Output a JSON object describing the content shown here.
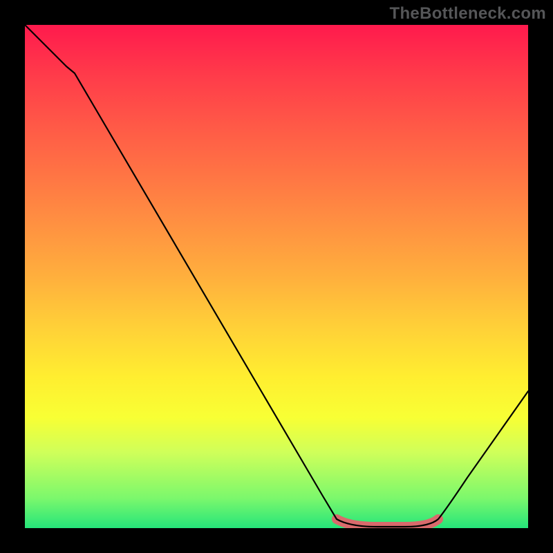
{
  "watermark": "TheBottleneck.com",
  "chart_data": {
    "type": "line",
    "title": "",
    "xlabel": "",
    "ylabel": "",
    "xlim": [
      0,
      100
    ],
    "ylim": [
      0,
      100
    ],
    "grid": false,
    "legend_position": "none",
    "x": [
      0,
      5,
      10,
      15,
      20,
      25,
      30,
      35,
      40,
      45,
      50,
      55,
      60,
      62,
      65,
      70,
      75,
      80,
      82,
      85,
      90,
      95,
      100
    ],
    "values": [
      100,
      96,
      91,
      83,
      75,
      67,
      59,
      51,
      43,
      35,
      27,
      18,
      9,
      6,
      2,
      0,
      0,
      0,
      2,
      6,
      13,
      20,
      27
    ],
    "series": [
      {
        "name": "bottleneck-curve",
        "x": [
          0,
          5,
          10,
          15,
          20,
          25,
          30,
          35,
          40,
          45,
          50,
          55,
          60,
          62,
          65,
          70,
          75,
          80,
          82,
          85,
          90,
          95,
          100
        ],
        "values": [
          100,
          96,
          91,
          83,
          75,
          67,
          59,
          51,
          43,
          35,
          27,
          18,
          9,
          6,
          2,
          0,
          0,
          0,
          2,
          6,
          13,
          20,
          27
        ]
      },
      {
        "name": "optimal-zone",
        "x": [
          62,
          70,
          75,
          82
        ],
        "values": [
          0,
          0,
          0,
          0
        ]
      }
    ],
    "colors": {
      "background_gradient_top": "#ff1a4d",
      "background_gradient_bottom": "#25e57a",
      "curve": "#000000",
      "optimal_zone": "#d96a6c"
    }
  }
}
